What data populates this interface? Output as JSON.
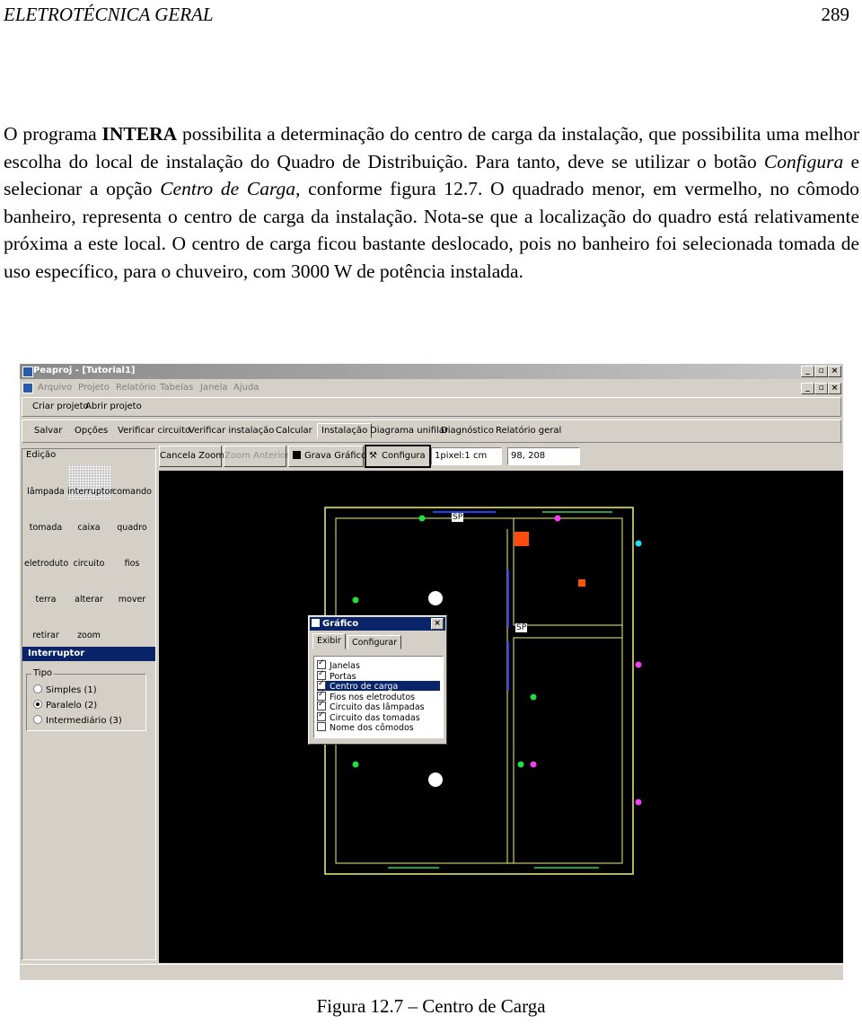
{
  "header": {
    "running_title": "ELETROTÉCNICA GERAL",
    "page_number": "289"
  },
  "body": {
    "p_1": "O programa ",
    "p_bold": "INTERA",
    "p_2": " possibilita a determinação do centro de carga da instalação, que possibilita uma melhor escolha do local de instalação do Quadro de Distribuição. Para tanto, deve se utilizar o botão ",
    "p_it1": "Configura",
    "p_3": " e selecionar a opção ",
    "p_it2": "Centro de Carga",
    "p_4": ", conforme figura 12.7. O quadrado menor, em vermelho, no cômodo banheiro, representa o centro de carga da instalação. Nota-se que a localização do quadro está relativamente próxima a este local. O centro de carga ficou bastante deslocado, pois no banheiro foi selecionada tomada de uso específico, para o chuveiro, com 3000 W de potência instalada."
  },
  "figure": {
    "caption": "Figura 12.7 – Centro de Carga",
    "window_title": "Peaproj - [Tutorial1]",
    "menu": [
      "Arquivo",
      "Projeto",
      "Relatório",
      "Tabelas",
      "Janela",
      "Ajuda"
    ],
    "toolbar1": [
      "Criar projeto",
      "Abrir projeto"
    ],
    "toolbar2": [
      "Salvar",
      "Opções",
      "Verificar circuito",
      "Verificar instalação",
      "Calcular",
      "Instalação",
      "Diagrama unifilar",
      "Diagnóstico",
      "Relatório geral"
    ],
    "toolbar3": {
      "cancel_zoom": "Cancela Zoom",
      "zoom_prev": "Zoom Anterior",
      "save_graph": "Grava Gráfico",
      "configure": "Configura",
      "scale": "1pixel:1 cm",
      "coords": "98, 208"
    },
    "panel": {
      "group_label": "Edição",
      "tools": [
        "lâmpada",
        "interruptor",
        "comando",
        "tomada",
        "caixa",
        "quadro",
        "eletroduto",
        "circuito",
        "fios",
        "terra",
        "alterar",
        "mover",
        "retirar",
        "zoom"
      ],
      "section_title": "Interruptor",
      "type_label": "Tipo",
      "options": [
        "Simples (1)",
        "Paralelo (2)",
        "Intermediário (3)"
      ],
      "selected_option": "Paralelo (2)"
    },
    "dialog": {
      "title": "Gráfico",
      "tabs": [
        "Exibir",
        "Configurar"
      ],
      "items": [
        {
          "label": "Janelas",
          "checked": true
        },
        {
          "label": "Portas",
          "checked": true
        },
        {
          "label": "Centro de carga",
          "checked": true
        },
        {
          "label": "Fios nos eletrodutos",
          "checked": true
        },
        {
          "label": "Circuito das lâmpadas",
          "checked": true
        },
        {
          "label": "Circuito das tomadas",
          "checked": true
        },
        {
          "label": "Nome dos cômodos",
          "checked": false
        }
      ]
    },
    "plan_labels": [
      "SP",
      "SP"
    ],
    "colors": {
      "wall": "#f0f080",
      "panel_box": "#ff4a10",
      "load_center": "#ff5010",
      "outlet_green": "#20e040",
      "outlet_magenta": "#f040f0",
      "outlet_cyan": "#20e0f0",
      "window_blue": "#2040ff",
      "window_green": "#20a040"
    }
  }
}
